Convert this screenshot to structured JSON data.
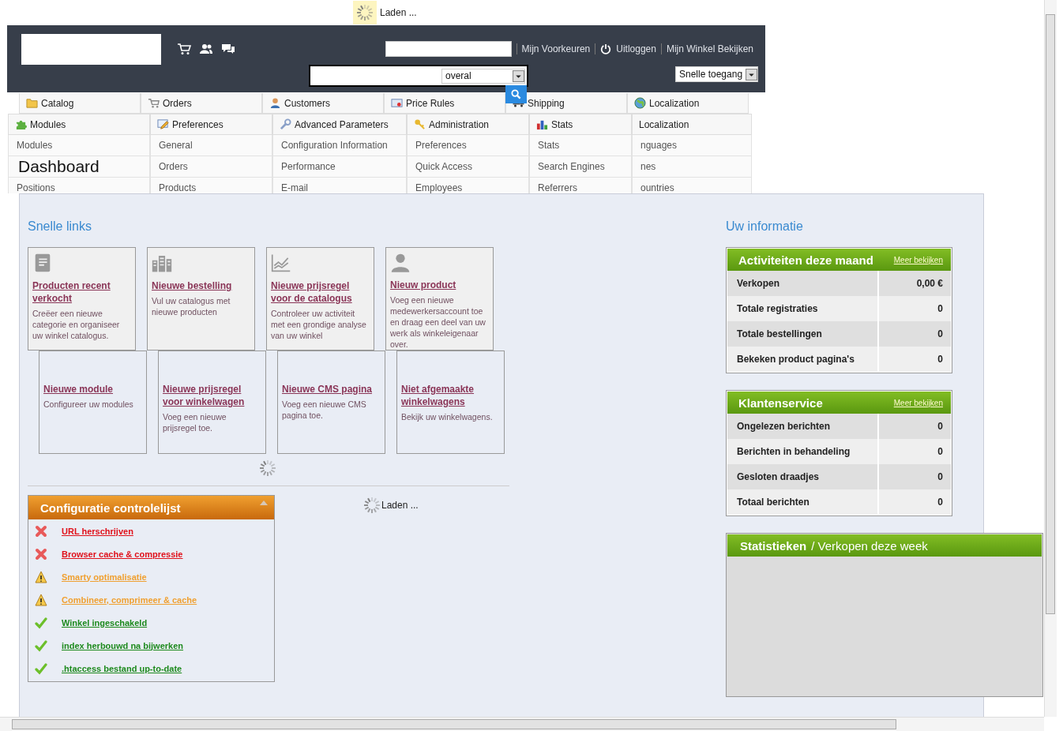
{
  "loading_bar": {
    "text": "Laden ..."
  },
  "header": {
    "user_links": [
      "Mijn Voorkeuren",
      "Uitloggen",
      "Mijn Winkel Bekijken"
    ],
    "search_scope": "overal",
    "quick_access": "Snelle toegang"
  },
  "menu": {
    "tabs": [
      {
        "label": "Catalog"
      },
      {
        "label": "Orders"
      },
      {
        "label": "Customers"
      },
      {
        "label": "Price Rules"
      },
      {
        "label": "Shipping"
      },
      {
        "label": "Localization"
      }
    ],
    "open_tabs": [
      {
        "label": "Modules",
        "items": [
          "Modules",
          "Positions"
        ]
      },
      {
        "label": "Preferences",
        "items": [
          "General",
          "Orders",
          "Products"
        ]
      },
      {
        "label": "Advanced Parameters",
        "items": [
          "Configuration Information",
          "Performance",
          "E-mail"
        ]
      },
      {
        "label": "Administration",
        "items": [
          "Preferences",
          "Quick Access",
          "Employees"
        ]
      },
      {
        "label": "Stats",
        "items": [
          "Stats",
          "Search Engines",
          "Referrers"
        ]
      },
      {
        "label": "Localization",
        "items": [
          "nguages",
          "nes",
          "ountries"
        ]
      }
    ]
  },
  "page_title": "Dashboard",
  "quick_links": {
    "title": "Snelle links",
    "items": [
      {
        "title": "Producten recent verkocht",
        "description": "Creëer een nieuwe categorie en organiseer uw winkel catalogus."
      },
      {
        "title": "Nieuwe bestelling",
        "description": "Vul uw catalogus met nieuwe producten"
      },
      {
        "title": "Nieuwe prijsregel voor de catalogus",
        "description": "Controleer uw activiteit met een grondige analyse van uw winkel"
      },
      {
        "title": "Nieuw product",
        "description": "Voeg een nieuwe medewerkersaccount toe en draag een deel van uw werk als winkeleigenaar over."
      },
      {
        "title": "Nieuwe module",
        "description": "Configureer uw modules"
      },
      {
        "title": "Nieuwe prijsregel voor winkelwagen",
        "description": "Voeg een nieuwe prijsregel toe."
      },
      {
        "title": "Nieuwe CMS pagina",
        "description": "Voeg een nieuwe CMS pagina toe."
      },
      {
        "title": "Niet afgemaakte winkelwagens",
        "description": "Bekijk uw winkelwagens."
      }
    ]
  },
  "checklist": {
    "title": "Configuratie controlelijst",
    "items": [
      {
        "label": "URL herschrijven",
        "kind": "error"
      },
      {
        "label": "Browser cache & compressie",
        "kind": "error"
      },
      {
        "label": "Smarty optimalisatie",
        "kind": "warning"
      },
      {
        "label": "Combineer, comprimeer & cache",
        "kind": "warning"
      },
      {
        "label": "Winkel ingeschakeld",
        "kind": "ok"
      },
      {
        "label": "index herbouwd na bijwerken",
        "kind": "ok"
      },
      {
        "label": ".htaccess bestand up-to-date",
        "kind": "ok"
      }
    ]
  },
  "loading_text": "Laden ...",
  "info": {
    "title": "Uw informatie",
    "panels": [
      {
        "title": "Activiteiten deze maand",
        "link": "Meer bekijken",
        "rows": [
          {
            "label": "Verkopen",
            "value": "0,00 €"
          },
          {
            "label": "Totale registraties",
            "value": "0"
          },
          {
            "label": "Totale bestellingen",
            "value": "0"
          },
          {
            "label": "Bekeken product pagina's",
            "value": "0"
          }
        ]
      },
      {
        "title": "Klantenservice",
        "link": "Meer bekijken",
        "rows": [
          {
            "label": "Ongelezen berichten",
            "value": "0"
          },
          {
            "label": "Berichten in behandeling",
            "value": "0"
          },
          {
            "label": "Gesloten draadjes",
            "value": "0"
          },
          {
            "label": "Totaal berichten",
            "value": "0"
          }
        ]
      }
    ],
    "stats": {
      "title": "Statistieken",
      "subtitle": "/ Verkopen deze week"
    }
  }
}
